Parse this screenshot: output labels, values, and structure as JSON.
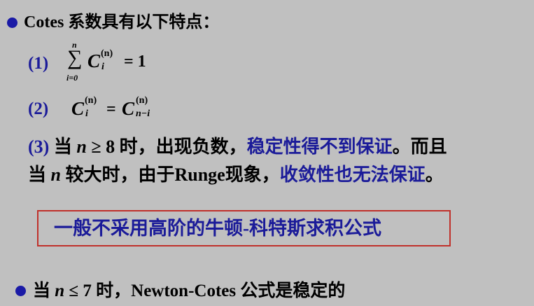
{
  "heading": {
    "text": "Cotes 系数具有以下特点："
  },
  "items": [
    {
      "label": "(1)",
      "formula": {
        "upper_limit": "n",
        "lower_limit": "i=0",
        "symbol": "C",
        "superscript": "(n)",
        "subscript": "i",
        "equals": "= 1"
      }
    },
    {
      "label": "(2)",
      "formula": {
        "left_symbol": "C",
        "left_superscript": "(n)",
        "left_subscript": "i",
        "equals": "=",
        "right_symbol": "C",
        "right_superscript": "(n)",
        "right_subscript": "n−i"
      }
    },
    {
      "label": "(3)",
      "line1": {
        "part1": "当 ",
        "var_n": "n",
        "part2": " ≥ 8 时，出现负数，",
        "blue_part": "稳定性得不到保证",
        "part3": "。而且"
      },
      "line2": {
        "part1": "当 ",
        "var_n": "n",
        "part2": " 较大时，由于Runge现象，",
        "blue_part": "收敛性也无法保证",
        "part3": "。"
      }
    }
  ],
  "boxed_statement": {
    "text": "一般不采用高阶的牛顿-科特斯求积公式"
  },
  "bottom_bullet": {
    "part1": "当 ",
    "var_n": "n",
    "part2": " ≤ 7 时，Newton-Cotes 公式是稳定的"
  },
  "colors": {
    "background": "#c0c0c0",
    "accent_blue": "#1b1b99",
    "bullet_blue": "#1a1aa6",
    "box_red": "#c0302b",
    "text": "#000000"
  }
}
